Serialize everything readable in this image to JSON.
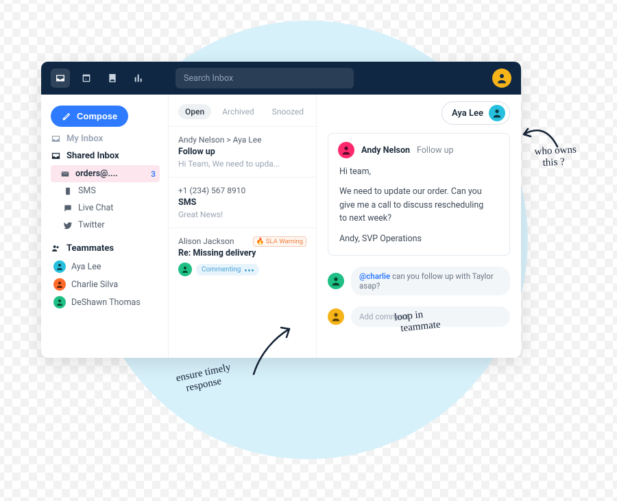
{
  "topbar": {
    "search_placeholder": "Search Inbox"
  },
  "sidebar": {
    "compose_label": "Compose",
    "my_inbox": "My Inbox",
    "shared_inbox": "Shared Inbox",
    "items": [
      {
        "label": "orders@....",
        "count": "3"
      },
      {
        "label": "SMS"
      },
      {
        "label": "Live Chat"
      },
      {
        "label": "Twitter"
      }
    ],
    "teammates_heading": "Teammates",
    "teammates": [
      {
        "name": "Aya Lee",
        "color": "#26c0de"
      },
      {
        "name": "Charlie Silva",
        "color": "#ff6a2a"
      },
      {
        "name": "DeShawn Thomas",
        "color": "#1fbf86"
      }
    ]
  },
  "tabs": {
    "open": "Open",
    "archived": "Archived",
    "snoozed": "Snoozed"
  },
  "messages": [
    {
      "from": "Andy Nelson > Aya Lee",
      "subject": "Follow up",
      "preview": "Hi Team, We need to upda..."
    },
    {
      "from": "+1 (234) 567 8910",
      "subject": "SMS",
      "preview": "Great News!"
    },
    {
      "from": "Alison Jackson",
      "subject": "Re: Missing delivery",
      "sla": "SLA Warning",
      "commenting": "Commenting"
    }
  ],
  "owner": {
    "name": "Aya Lee"
  },
  "email": {
    "from": "Andy Nelson",
    "subject": "Follow up",
    "body_line1": "Hi team,",
    "body_line2": "We need to update our order. Can you give me a call to discuss rescheduling to next week?",
    "body_line3": "Andy, SVP Operations"
  },
  "comment": {
    "mention": "@charlie",
    "text": " can you follow up with Taylor asap?"
  },
  "add_comment_placeholder": "Add comment",
  "annotations": {
    "owns": "who owns\n   this ?",
    "timely": "ensure timely\n   response",
    "loop": "loop in\n  teammate"
  }
}
